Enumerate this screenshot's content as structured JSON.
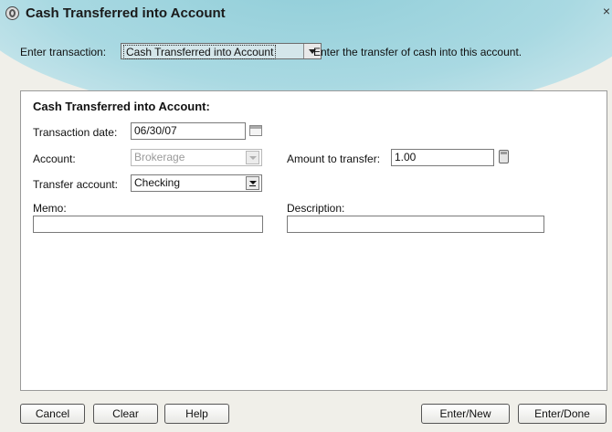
{
  "window": {
    "title": "Cash Transferred into Account",
    "close_glyph": "×"
  },
  "transaction": {
    "label": "Enter transaction:",
    "selected": "Cash Transferred into Account",
    "hint": "Enter the transfer of cash into this account."
  },
  "form": {
    "heading": "Cash Transferred into Account:",
    "date_label": "Transaction date:",
    "date_value": "06/30/07",
    "account_label": "Account:",
    "account_value": "Brokerage",
    "amount_label": "Amount to transfer:",
    "amount_value": "1.00",
    "transfer_label": "Transfer account:",
    "transfer_value": "Checking",
    "memo_label": "Memo:",
    "memo_value": "",
    "description_label": "Description:",
    "description_value": ""
  },
  "buttons": {
    "cancel": "Cancel",
    "clear": "Clear",
    "help": "Help",
    "enter_new": "Enter/New",
    "enter_done": "Enter/Done"
  },
  "colors": {
    "accent_teal": "#a9d9e2",
    "panel_bg": "#ffffff",
    "window_bg": "#f0efe9"
  }
}
